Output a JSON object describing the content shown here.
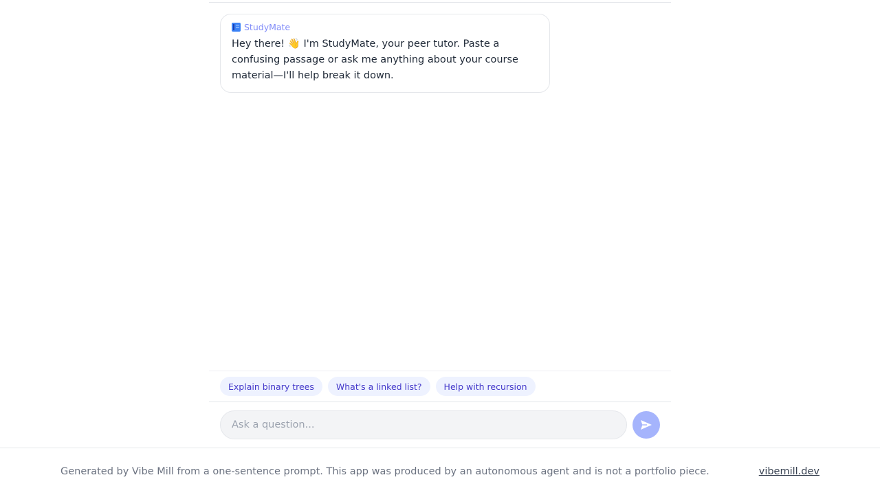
{
  "assistant": {
    "name": "StudyMate",
    "icon": "book-icon",
    "greeting": "Hey there! 👋 I'm StudyMate, your peer tutor. Paste a confusing passage or ask me anything about your course material—I'll help break it down."
  },
  "suggestions": [
    "Explain binary trees",
    "What's a linked list?",
    "Help with recursion"
  ],
  "composer": {
    "placeholder": "Ask a question...",
    "value": "",
    "send_icon": "send-icon"
  },
  "footer": {
    "note": "Generated by Vibe Mill from a one-sentence prompt. This app was produced by an autonomous agent and is not a portfolio piece.",
    "link": "vibemill.dev"
  },
  "colors": {
    "accent": "#818cf8",
    "chip_background": "#eef2ff",
    "chip_text": "#4338ca",
    "send_button": "#a5b4fc"
  }
}
